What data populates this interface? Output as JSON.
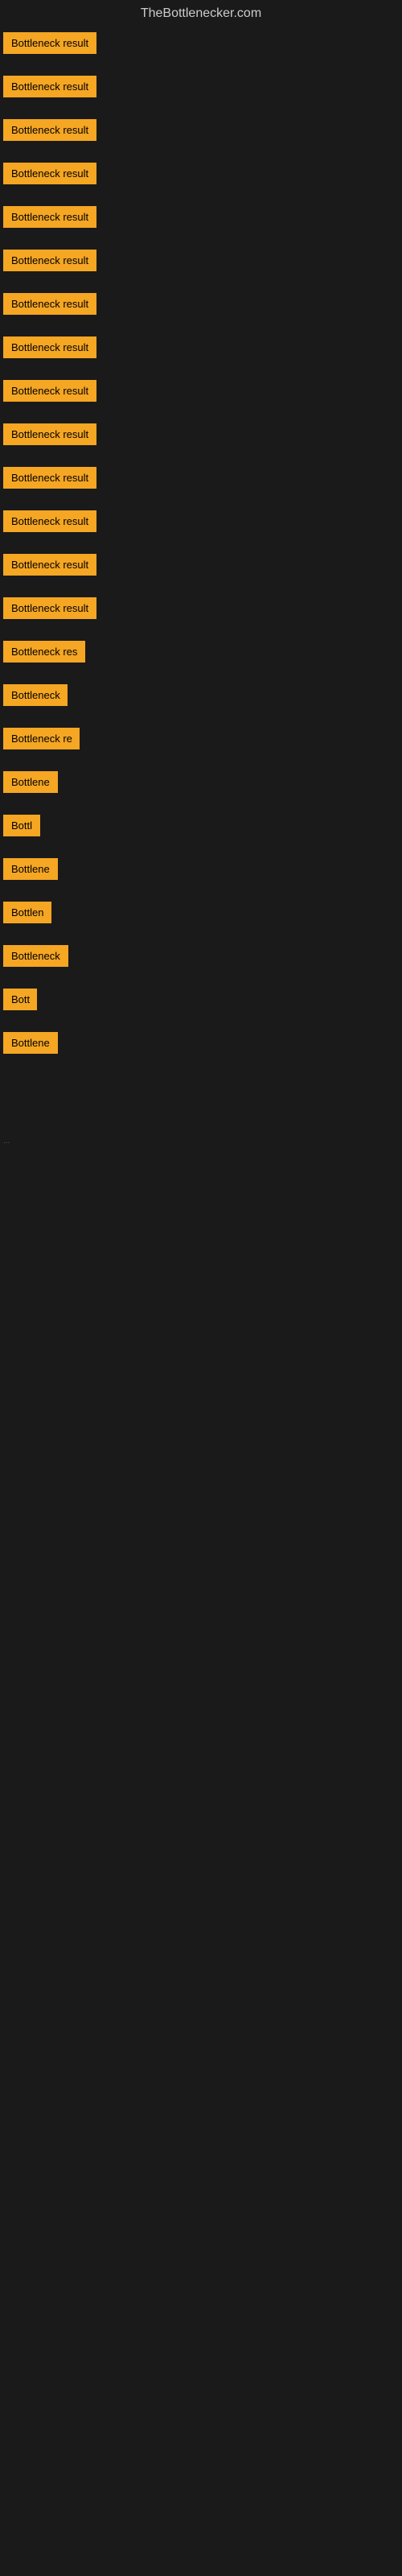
{
  "site": {
    "title": "TheBottlenecker.com"
  },
  "items": [
    {
      "label": "Bottleneck result",
      "width": 130
    },
    {
      "label": "Bottleneck result",
      "width": 130
    },
    {
      "label": "Bottleneck result",
      "width": 130
    },
    {
      "label": "Bottleneck result",
      "width": 130
    },
    {
      "label": "Bottleneck result",
      "width": 130
    },
    {
      "label": "Bottleneck result",
      "width": 130
    },
    {
      "label": "Bottleneck result",
      "width": 130
    },
    {
      "label": "Bottleneck result",
      "width": 130
    },
    {
      "label": "Bottleneck result",
      "width": 130
    },
    {
      "label": "Bottleneck result",
      "width": 130
    },
    {
      "label": "Bottleneck result",
      "width": 130
    },
    {
      "label": "Bottleneck result",
      "width": 130
    },
    {
      "label": "Bottleneck result",
      "width": 130
    },
    {
      "label": "Bottleneck result",
      "width": 130
    },
    {
      "label": "Bottleneck res",
      "width": 110
    },
    {
      "label": "Bottleneck",
      "width": 80
    },
    {
      "label": "Bottleneck re",
      "width": 95
    },
    {
      "label": "Bottlene",
      "width": 70
    },
    {
      "label": "Bottl",
      "width": 48
    },
    {
      "label": "Bottlene",
      "width": 70
    },
    {
      "label": "Bottlen",
      "width": 60
    },
    {
      "label": "Bottleneck",
      "width": 82
    },
    {
      "label": "Bott",
      "width": 42
    },
    {
      "label": "Bottlene",
      "width": 70
    }
  ],
  "footer_text": "..."
}
